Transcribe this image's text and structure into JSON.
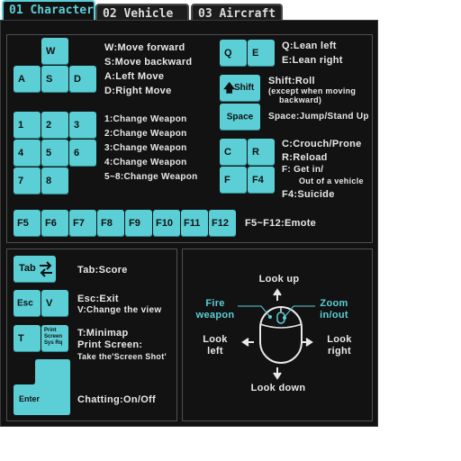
{
  "tabs": [
    {
      "label": "01 Character",
      "active": true
    },
    {
      "label": "02 Vehicle",
      "active": false
    },
    {
      "label": "03 Aircraft",
      "active": false
    }
  ],
  "movement": {
    "keys": {
      "w": "W",
      "a": "A",
      "s": "S",
      "d": "D"
    },
    "lines": [
      "W:Move forward",
      "S:Move backward",
      "A:Left Move",
      "D:Right Move"
    ]
  },
  "lean": {
    "keys": {
      "q": "Q",
      "e": "E"
    },
    "lines": [
      "Q:Lean left",
      "E:Lean right"
    ]
  },
  "shift": {
    "key": "Shift",
    "line": "Shift:Roll",
    "note1": "(except when moving",
    "note2": "backward)"
  },
  "space": {
    "key": "Space",
    "line": "Space:Jump/Stand Up"
  },
  "weapons": {
    "keys": [
      "1",
      "2",
      "3",
      "4",
      "5",
      "6",
      "7",
      "8"
    ],
    "lines": [
      "1:Change Weapon",
      "2:Change Weapon",
      "3:Change Weapon",
      "4:Change Weapon",
      "5~8:Change Weapon"
    ]
  },
  "stance": {
    "keys": {
      "c": "C",
      "r": "R",
      "f": "F",
      "f4": "F4"
    },
    "lines": [
      "C:Crouch/Prone",
      "R:Reload",
      "F: Get in/",
      "Out of a vehicle",
      "F4:Suicide"
    ]
  },
  "emotes": {
    "keys": [
      "F5",
      "F6",
      "F7",
      "F8",
      "F9",
      "F10",
      "F11",
      "F12"
    ],
    "line": "F5~F12:Emote"
  },
  "misc": {
    "tab_key": "Tab",
    "tab_line": "Tab:Score",
    "esc_key": "Esc",
    "v_key": "V",
    "esc_line": "Esc:Exit",
    "v_line": "V:Change the view",
    "t_key": "T",
    "print_key1": "Print",
    "print_key2": "Screen",
    "print_key3": "Sys Rq",
    "t_line": "T:Minimap",
    "print_line": "Print Screen:",
    "print_note": "Take the'Screen Shot'",
    "enter_key": "Enter",
    "enter_line": "Chatting:On/Off"
  },
  "mouse": {
    "look_up": "Look up",
    "look_down": "Look down",
    "look_left1": "Look",
    "look_left2": "left",
    "look_right1": "Look",
    "look_right2": "right",
    "fire1": "Fire",
    "fire2": "weapon",
    "zoom1": "Zoom",
    "zoom2": "in/out"
  },
  "colors": {
    "accent": "#5ccfd6",
    "panel": "#121212",
    "text": "#e8e8e8"
  }
}
